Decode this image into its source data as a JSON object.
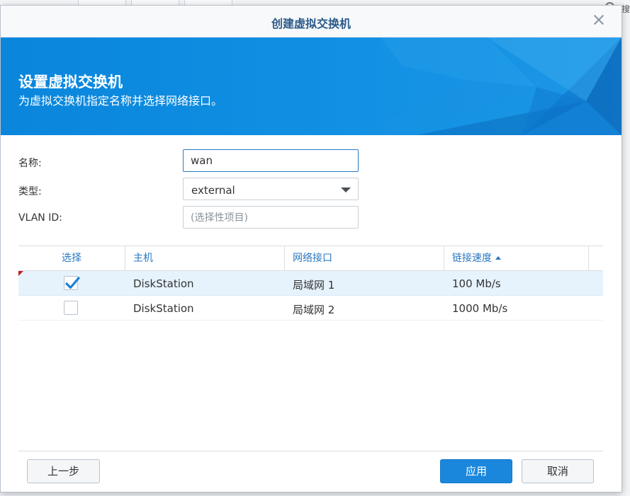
{
  "background": {
    "right_text": "搜"
  },
  "dialog": {
    "title": "创建虚拟交换机",
    "banner": {
      "title": "设置虚拟交换机",
      "subtitle": "为虚拟交换机指定名称并选择网络接口。"
    },
    "form": {
      "name_label": "名称:",
      "name_value": "wan",
      "type_label": "类型:",
      "type_value": "external",
      "vlan_label": "VLAN ID:",
      "vlan_placeholder": "(选择性项目)"
    },
    "grid": {
      "columns": [
        "选择",
        "主机",
        "网络接口",
        "链接速度"
      ],
      "sorted_column": "链接速度",
      "sort_direction": "ascending",
      "rows": [
        {
          "checked": true,
          "host": "DiskStation",
          "interface": "局域网 1",
          "speed": "100 Mb/s",
          "selected": true
        },
        {
          "checked": false,
          "host": "DiskStation",
          "interface": "局域网 2",
          "speed": "1000 Mb/s",
          "selected": false
        }
      ]
    },
    "buttons": {
      "back": "上一步",
      "apply": "应用",
      "cancel": "取消"
    }
  },
  "colors": {
    "accent": "#1a87dd",
    "title_text": "#2c5a8a",
    "banner": "#0f8ee2",
    "header_text": "#2a78c0"
  }
}
